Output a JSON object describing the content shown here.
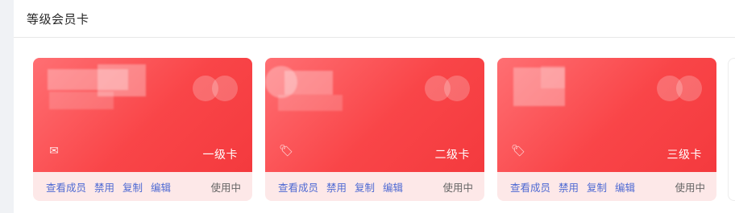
{
  "panel": {
    "title": "等级会员卡"
  },
  "cards": [
    {
      "level": "一级卡",
      "icon": "mail-icon",
      "icon_glyph": "✉",
      "status": "使用中",
      "actions": [
        "查看成员",
        "禁用",
        "复制",
        "编辑"
      ]
    },
    {
      "level": "二级卡",
      "icon": "tag-icon",
      "icon_glyph": "🏷",
      "status": "使用中",
      "actions": [
        "查看成员",
        "禁用",
        "复制",
        "编辑"
      ]
    },
    {
      "level": "三级卡",
      "icon": "tag-icon",
      "icon_glyph": "🏷",
      "status": "使用中",
      "actions": [
        "查看成员",
        "禁用",
        "复制",
        "编辑"
      ]
    }
  ],
  "colors": {
    "card_red": "#f94548",
    "footer_bg": "#fde8e8",
    "action_blue": "#4e6ad3"
  }
}
